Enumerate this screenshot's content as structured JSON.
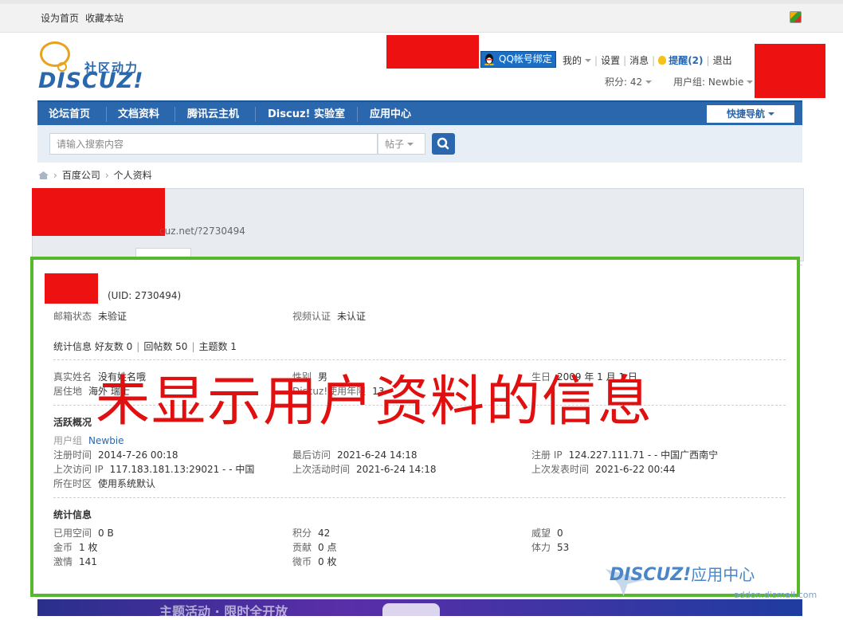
{
  "topbar": {
    "set_home": "设为首页",
    "bookmark": "收藏本站"
  },
  "logo": {
    "cn": "社区动力",
    "en": "DISCUZ!"
  },
  "user": {
    "qq_bind": "QQ帐号绑定",
    "my": "我的",
    "settings": "设置",
    "messages": "消息",
    "remind": "提醒(2)",
    "logout": "退出",
    "points": "积分: 42",
    "usergroup": "用户组: Newbie"
  },
  "nav": {
    "items": [
      "论坛首页",
      "文档资料",
      "腾讯云主机",
      "Discuz! 实验室",
      "应用中心"
    ],
    "quick_nav": "快捷导航"
  },
  "search": {
    "placeholder": "请输入搜索内容",
    "type": "帖子"
  },
  "breadcrumb": {
    "items": [
      "百度公司",
      "个人资料"
    ]
  },
  "profile": {
    "url_partial": "cuz.net/?2730494",
    "uid": "(UID: 2730494)",
    "email_status": {
      "label": "邮箱状态",
      "value": "未验证"
    },
    "video_auth": {
      "label": "视频认证",
      "value": "未认证"
    },
    "stats": {
      "label": "统计信息",
      "friends": "好友数 0",
      "replies": "回帖数 50",
      "threads": "主题数 1"
    },
    "realname": {
      "label": "真实姓名",
      "value": "没有姓名哦"
    },
    "gender": {
      "label": "性别",
      "value": "男"
    },
    "birthday": {
      "label": "生日",
      "value": "2009 年 1 月 1 日"
    },
    "residence": {
      "label": "居住地",
      "value": "海外 瑞士"
    },
    "discuz_years": {
      "label": "Discuz!使用年限",
      "value": "13"
    },
    "activity": {
      "title": "活跃概况",
      "usergroup": {
        "label": "用户组",
        "value": "Newbie"
      },
      "reg_time": {
        "label": "注册时间",
        "value": "2014-7-26 00:18"
      },
      "last_visit": {
        "label": "最后访问",
        "value": "2021-6-24 14:18"
      },
      "reg_ip": {
        "label": "注册 IP",
        "value": "124.227.111.71 - - 中国广西南宁"
      },
      "last_ip": {
        "label": "上次访问 IP",
        "value": "117.183.181.13:29021 - - 中国"
      },
      "last_active": {
        "label": "上次活动时间",
        "value": "2021-6-24 14:18"
      },
      "last_post": {
        "label": "上次发表时间",
        "value": "2021-6-22 00:44"
      },
      "timezone": {
        "label": "所在时区",
        "value": "使用系统默认"
      }
    },
    "statistics": {
      "title": "统计信息",
      "space": {
        "label": "已用空间",
        "value": "0 B"
      },
      "points": {
        "label": "积分",
        "value": "42"
      },
      "prestige": {
        "label": "威望",
        "value": "0"
      },
      "money": {
        "label": "金币",
        "value": "1 枚"
      },
      "contrib": {
        "label": "贡献",
        "value": "0 点"
      },
      "stamina": {
        "label": "体力",
        "value": "53"
      },
      "passion": {
        "label": "激情",
        "value": "141"
      },
      "weibi": {
        "label": "微币",
        "value": "0 枚"
      }
    }
  },
  "overlay_text": "未显示用户资料的信息",
  "watermark": {
    "en": "DISCUZ!",
    "cn": "应用中心",
    "url": "addon.dismall.com"
  },
  "banner": {
    "text": "主题活动 · 限时全开放"
  },
  "colors": {
    "nav": "#2b67ad",
    "frame": "#57b82c",
    "overlay": "#e01010",
    "redact": "#ee1111"
  }
}
